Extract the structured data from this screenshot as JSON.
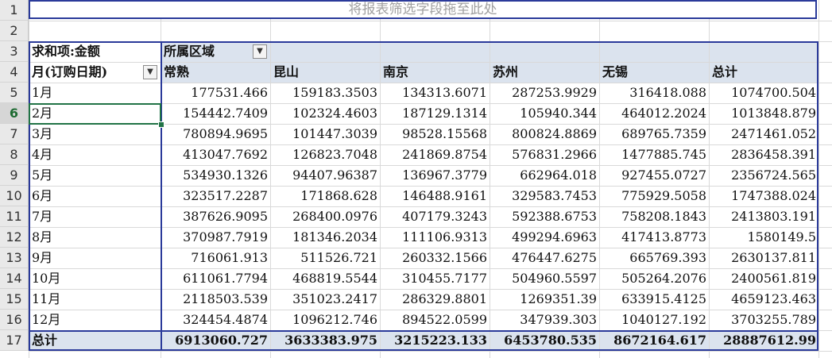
{
  "sheet": {
    "row_numbers": [
      "1",
      "2",
      "3",
      "4",
      "5",
      "6",
      "7",
      "8",
      "9",
      "10",
      "11",
      "12",
      "13",
      "14",
      "15",
      "16",
      "17"
    ],
    "filter_drop_text": "将报表筛选字段拖至此处",
    "pivot": {
      "sum_label": "求和项:金额",
      "col_field_label": "所属区域",
      "row_field_label": "月(订购日期)",
      "columns": [
        "常熟",
        "昆山",
        "南京",
        "苏州",
        "无锡",
        "总计"
      ],
      "rows": [
        {
          "label": "1月",
          "values": [
            "177531.466",
            "159183.3503",
            "134313.6071",
            "287253.9929",
            "316418.088",
            "1074700.504"
          ]
        },
        {
          "label": "2月",
          "values": [
            "154442.7409",
            "102324.4603",
            "187129.1314",
            "105940.344",
            "464012.2024",
            "1013848.879"
          ]
        },
        {
          "label": "3月",
          "values": [
            "780894.9695",
            "101447.3039",
            "98528.15568",
            "800824.8869",
            "689765.7359",
            "2471461.052"
          ]
        },
        {
          "label": "4月",
          "values": [
            "413047.7692",
            "126823.7048",
            "241869.8754",
            "576831.2966",
            "1477885.745",
            "2836458.391"
          ]
        },
        {
          "label": "5月",
          "values": [
            "534930.1326",
            "94407.96387",
            "136967.3779",
            "662964.018",
            "927455.0727",
            "2356724.565"
          ]
        },
        {
          "label": "6月",
          "values": [
            "323517.2287",
            "171868.628",
            "146488.9161",
            "329583.7453",
            "775929.5058",
            "1747388.024"
          ]
        },
        {
          "label": "7月",
          "values": [
            "387626.9095",
            "268400.0976",
            "407179.3243",
            "592388.6753",
            "758208.1843",
            "2413803.191"
          ]
        },
        {
          "label": "8月",
          "values": [
            "370987.7919",
            "181346.2034",
            "111106.9313",
            "499294.6963",
            "417413.8773",
            "1580149.5"
          ]
        },
        {
          "label": "9月",
          "values": [
            "716061.913",
            "511526.721",
            "260332.1566",
            "476447.6275",
            "665769.393",
            "2630137.811"
          ]
        },
        {
          "label": "10月",
          "values": [
            "611061.7794",
            "468819.5544",
            "310455.7177",
            "504960.5597",
            "505264.2076",
            "2400561.819"
          ]
        },
        {
          "label": "11月",
          "values": [
            "2118503.539",
            "351023.2417",
            "286329.8801",
            "1269351.39",
            "633915.4125",
            "4659123.463"
          ]
        },
        {
          "label": "12月",
          "values": [
            "324454.4874",
            "1096212.746",
            "894522.0599",
            "347939.303",
            "1040127.192",
            "3703255.789"
          ]
        }
      ],
      "total": {
        "label": "总计",
        "values": [
          "6913060.727",
          "3633383.975",
          "3215223.133",
          "6453780.535",
          "8672164.617",
          "28887612.99"
        ]
      }
    },
    "selected_row": "6",
    "colors": {
      "pivot_border": "#2a3a9a",
      "header_band": "#dbe3ee",
      "selection": "#217346"
    }
  }
}
